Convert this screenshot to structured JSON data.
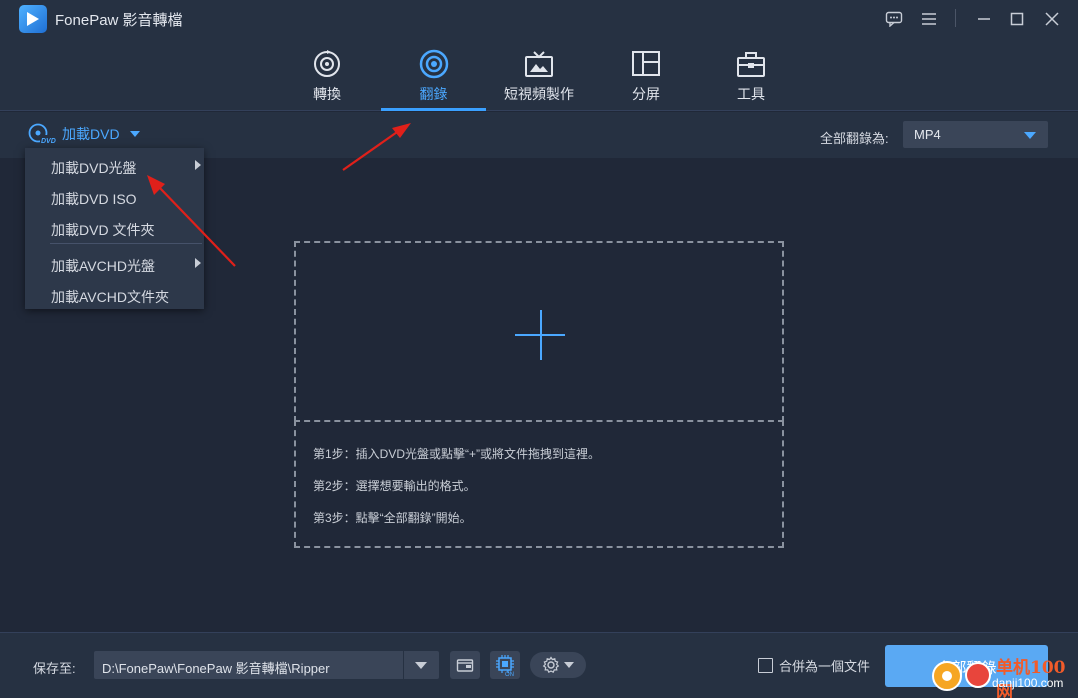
{
  "app": {
    "title": "FonePaw 影音轉檔"
  },
  "window_controls": [
    "feedback-icon",
    "menu-icon",
    "minimize-icon",
    "maximize-icon",
    "close-icon"
  ],
  "tabs": [
    {
      "label": "轉換",
      "icon": "convert-disc-icon",
      "active": false
    },
    {
      "label": "翻錄",
      "icon": "ripper-icon",
      "active": true
    },
    {
      "label": "短視頻製作",
      "icon": "tv-icon",
      "active": false
    },
    {
      "label": "分屏",
      "icon": "split-screen-icon",
      "active": false
    },
    {
      "label": "工具",
      "icon": "toolbox-icon",
      "active": false
    }
  ],
  "toolbar": {
    "load_dvd_label": "加載DVD",
    "format_label": "全部翻錄為:",
    "format_value": "MP4"
  },
  "dropdown": {
    "items": [
      {
        "label": "加載DVD光盤",
        "submenu": true
      },
      {
        "label": "加載DVD ISO",
        "submenu": false
      },
      {
        "label": "加載DVD 文件夾",
        "submenu": false
      },
      {
        "label": "加載AVCHD光盤",
        "submenu": true
      },
      {
        "label": "加載AVCHD文件夾",
        "submenu": false
      }
    ]
  },
  "steps": [
    "第1步：插入DVD光盤或點擊“+”或將文件拖拽到這裡。",
    "第2步：選擇想要輸出的格式。",
    "第3步：點擊“全部翻錄”開始。"
  ],
  "bottom": {
    "save_label": "保存至:",
    "path": "D:\\FonePaw\\FonePaw 影音轉檔\\Ripper",
    "merge_label": "合併為一個文件",
    "convert_label": "全部翻錄"
  },
  "watermark": {
    "top": "单机100网",
    "bottom": "danji100.com"
  },
  "colors": {
    "accent": "#4ba8ff",
    "background": "#202838",
    "panel": "#263142",
    "arrow": "#e0201a"
  }
}
